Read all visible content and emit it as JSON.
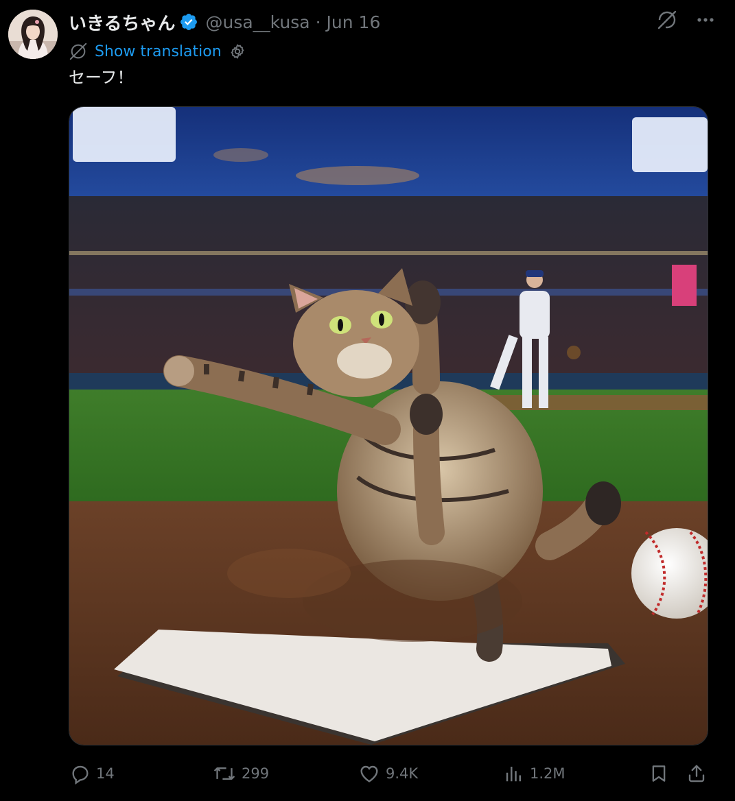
{
  "author": {
    "display_name": "いきるちゃん",
    "handle": "@usa__kusa",
    "separator": "·",
    "date": "Jun 16",
    "verified": true
  },
  "translation": {
    "label": "Show translation"
  },
  "tweet": {
    "text": "セーフ！"
  },
  "media": {
    "alt": "A tabby cat sliding into home plate at a night baseball stadium"
  },
  "actions": {
    "replies": "14",
    "reposts": "299",
    "likes": "9.4K",
    "views": "1.2M"
  },
  "colors": {
    "background": "#000000",
    "primary_text": "#e7e9ea",
    "secondary_text": "#71767b",
    "accent": "#1d9bf0"
  },
  "icons": {
    "verified": "verified-badge-icon",
    "grok": "grok-icon",
    "more": "more-icon",
    "translate": "translate-icon",
    "settings": "gear-icon",
    "reply": "reply-icon",
    "repost": "repost-icon",
    "like": "heart-icon",
    "views": "views-icon",
    "bookmark": "bookmark-icon",
    "share": "share-icon"
  }
}
